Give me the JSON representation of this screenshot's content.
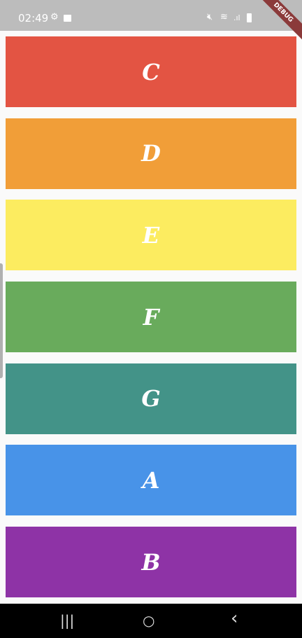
{
  "status_bar": {
    "time": "02:49",
    "icons": [
      "gear-icon",
      "image-icon",
      "mute-icon",
      "wifi-icon",
      "signal-icon",
      "battery-icon"
    ],
    "debug_banner": "DEBUG"
  },
  "cards": [
    {
      "label": "C",
      "color": "#e35443"
    },
    {
      "label": "D",
      "color": "#f19e38"
    },
    {
      "label": "E",
      "color": "#fcec60"
    },
    {
      "label": "F",
      "color": "#69ab5c"
    },
    {
      "label": "G",
      "color": "#439388"
    },
    {
      "label": "A",
      "color": "#4893e8"
    },
    {
      "label": "B",
      "color": "#8e33a6"
    }
  ],
  "nav_bar": {
    "recents": "|||",
    "home": "○",
    "back": "‹"
  }
}
